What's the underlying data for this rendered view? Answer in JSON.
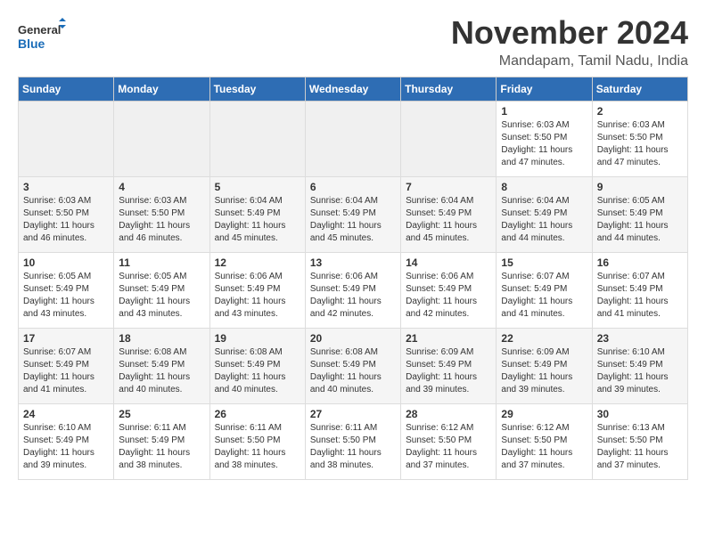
{
  "header": {
    "logo_line1": "General",
    "logo_line2": "Blue",
    "month_title": "November 2024",
    "location": "Mandapam, Tamil Nadu, India"
  },
  "days_of_week": [
    "Sunday",
    "Monday",
    "Tuesday",
    "Wednesday",
    "Thursday",
    "Friday",
    "Saturday"
  ],
  "weeks": [
    {
      "row_index": 0,
      "cells": [
        {
          "day": null,
          "info": null
        },
        {
          "day": null,
          "info": null
        },
        {
          "day": null,
          "info": null
        },
        {
          "day": null,
          "info": null
        },
        {
          "day": null,
          "info": null
        },
        {
          "day": "1",
          "info": "Sunrise: 6:03 AM\nSunset: 5:50 PM\nDaylight: 11 hours and 47 minutes."
        },
        {
          "day": "2",
          "info": "Sunrise: 6:03 AM\nSunset: 5:50 PM\nDaylight: 11 hours and 47 minutes."
        }
      ]
    },
    {
      "row_index": 1,
      "cells": [
        {
          "day": "3",
          "info": "Sunrise: 6:03 AM\nSunset: 5:50 PM\nDaylight: 11 hours and 46 minutes."
        },
        {
          "day": "4",
          "info": "Sunrise: 6:03 AM\nSunset: 5:50 PM\nDaylight: 11 hours and 46 minutes."
        },
        {
          "day": "5",
          "info": "Sunrise: 6:04 AM\nSunset: 5:49 PM\nDaylight: 11 hours and 45 minutes."
        },
        {
          "day": "6",
          "info": "Sunrise: 6:04 AM\nSunset: 5:49 PM\nDaylight: 11 hours and 45 minutes."
        },
        {
          "day": "7",
          "info": "Sunrise: 6:04 AM\nSunset: 5:49 PM\nDaylight: 11 hours and 45 minutes."
        },
        {
          "day": "8",
          "info": "Sunrise: 6:04 AM\nSunset: 5:49 PM\nDaylight: 11 hours and 44 minutes."
        },
        {
          "day": "9",
          "info": "Sunrise: 6:05 AM\nSunset: 5:49 PM\nDaylight: 11 hours and 44 minutes."
        }
      ]
    },
    {
      "row_index": 2,
      "cells": [
        {
          "day": "10",
          "info": "Sunrise: 6:05 AM\nSunset: 5:49 PM\nDaylight: 11 hours and 43 minutes."
        },
        {
          "day": "11",
          "info": "Sunrise: 6:05 AM\nSunset: 5:49 PM\nDaylight: 11 hours and 43 minutes."
        },
        {
          "day": "12",
          "info": "Sunrise: 6:06 AM\nSunset: 5:49 PM\nDaylight: 11 hours and 43 minutes."
        },
        {
          "day": "13",
          "info": "Sunrise: 6:06 AM\nSunset: 5:49 PM\nDaylight: 11 hours and 42 minutes."
        },
        {
          "day": "14",
          "info": "Sunrise: 6:06 AM\nSunset: 5:49 PM\nDaylight: 11 hours and 42 minutes."
        },
        {
          "day": "15",
          "info": "Sunrise: 6:07 AM\nSunset: 5:49 PM\nDaylight: 11 hours and 41 minutes."
        },
        {
          "day": "16",
          "info": "Sunrise: 6:07 AM\nSunset: 5:49 PM\nDaylight: 11 hours and 41 minutes."
        }
      ]
    },
    {
      "row_index": 3,
      "cells": [
        {
          "day": "17",
          "info": "Sunrise: 6:07 AM\nSunset: 5:49 PM\nDaylight: 11 hours and 41 minutes."
        },
        {
          "day": "18",
          "info": "Sunrise: 6:08 AM\nSunset: 5:49 PM\nDaylight: 11 hours and 40 minutes."
        },
        {
          "day": "19",
          "info": "Sunrise: 6:08 AM\nSunset: 5:49 PM\nDaylight: 11 hours and 40 minutes."
        },
        {
          "day": "20",
          "info": "Sunrise: 6:08 AM\nSunset: 5:49 PM\nDaylight: 11 hours and 40 minutes."
        },
        {
          "day": "21",
          "info": "Sunrise: 6:09 AM\nSunset: 5:49 PM\nDaylight: 11 hours and 39 minutes."
        },
        {
          "day": "22",
          "info": "Sunrise: 6:09 AM\nSunset: 5:49 PM\nDaylight: 11 hours and 39 minutes."
        },
        {
          "day": "23",
          "info": "Sunrise: 6:10 AM\nSunset: 5:49 PM\nDaylight: 11 hours and 39 minutes."
        }
      ]
    },
    {
      "row_index": 4,
      "cells": [
        {
          "day": "24",
          "info": "Sunrise: 6:10 AM\nSunset: 5:49 PM\nDaylight: 11 hours and 39 minutes."
        },
        {
          "day": "25",
          "info": "Sunrise: 6:11 AM\nSunset: 5:49 PM\nDaylight: 11 hours and 38 minutes."
        },
        {
          "day": "26",
          "info": "Sunrise: 6:11 AM\nSunset: 5:50 PM\nDaylight: 11 hours and 38 minutes."
        },
        {
          "day": "27",
          "info": "Sunrise: 6:11 AM\nSunset: 5:50 PM\nDaylight: 11 hours and 38 minutes."
        },
        {
          "day": "28",
          "info": "Sunrise: 6:12 AM\nSunset: 5:50 PM\nDaylight: 11 hours and 37 minutes."
        },
        {
          "day": "29",
          "info": "Sunrise: 6:12 AM\nSunset: 5:50 PM\nDaylight: 11 hours and 37 minutes."
        },
        {
          "day": "30",
          "info": "Sunrise: 6:13 AM\nSunset: 5:50 PM\nDaylight: 11 hours and 37 minutes."
        }
      ]
    }
  ]
}
